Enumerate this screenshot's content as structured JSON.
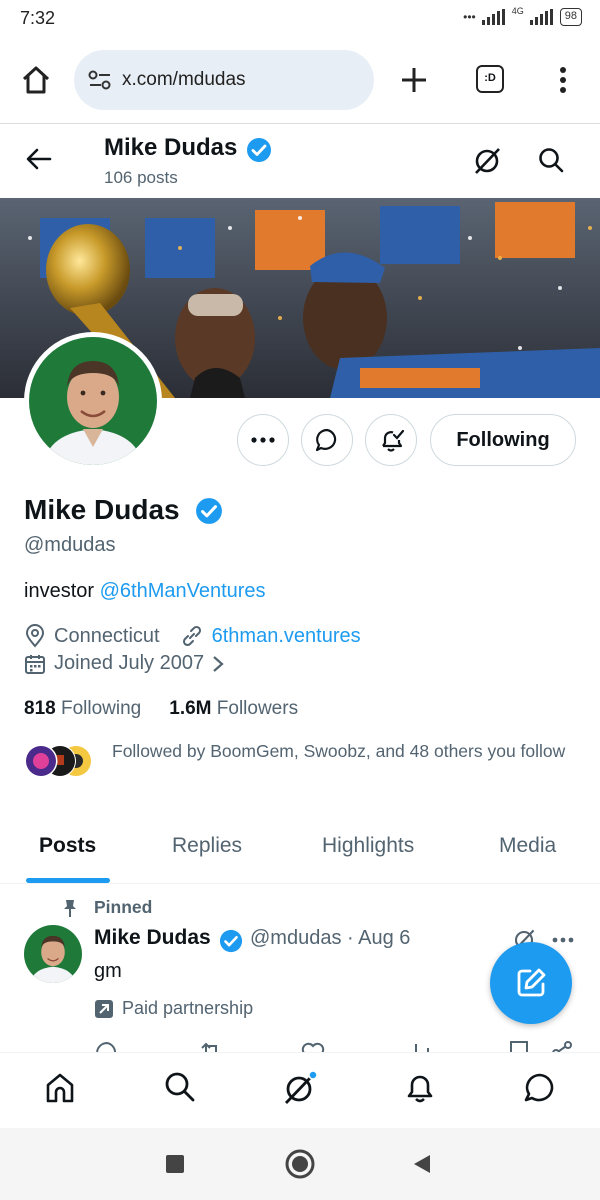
{
  "status_bar": {
    "time": "7:32",
    "network": "4G",
    "battery": "98"
  },
  "browser": {
    "url": "x.com/mdudas",
    "tab_count": ":D"
  },
  "header": {
    "name": "Mike Dudas",
    "posts_count": "106 posts"
  },
  "profile": {
    "name": "Mike Dudas",
    "handle": "@mdudas",
    "bio_prefix": "investor ",
    "bio_link": "@6thManVentures",
    "location": "Connecticut",
    "website": "6thman.ventures",
    "joined": "Joined July 2007",
    "following_count": "818",
    "following_label": "Following",
    "followers_count": "1.6M",
    "followers_label": "Followers",
    "followed_by": "Followed by BoomGem, Swoobz, and 48 others you follow",
    "following_button": "Following"
  },
  "tabs": [
    {
      "label": "Posts",
      "active": true
    },
    {
      "label": "Replies",
      "active": false
    },
    {
      "label": "Highlights",
      "active": false
    },
    {
      "label": "Media",
      "active": false
    }
  ],
  "pinned_tweet": {
    "pinned_label": "Pinned",
    "name": "Mike Dudas",
    "meta": "@mdudas · Aug 6",
    "text": "gm",
    "paid_partnership": "Paid partnership"
  },
  "colors": {
    "accent": "#1d9bf0",
    "text_primary": "#0f1419",
    "text_secondary": "#536471",
    "verified": "#1d9bf0",
    "avatar_bg": "#1f7a3a"
  }
}
